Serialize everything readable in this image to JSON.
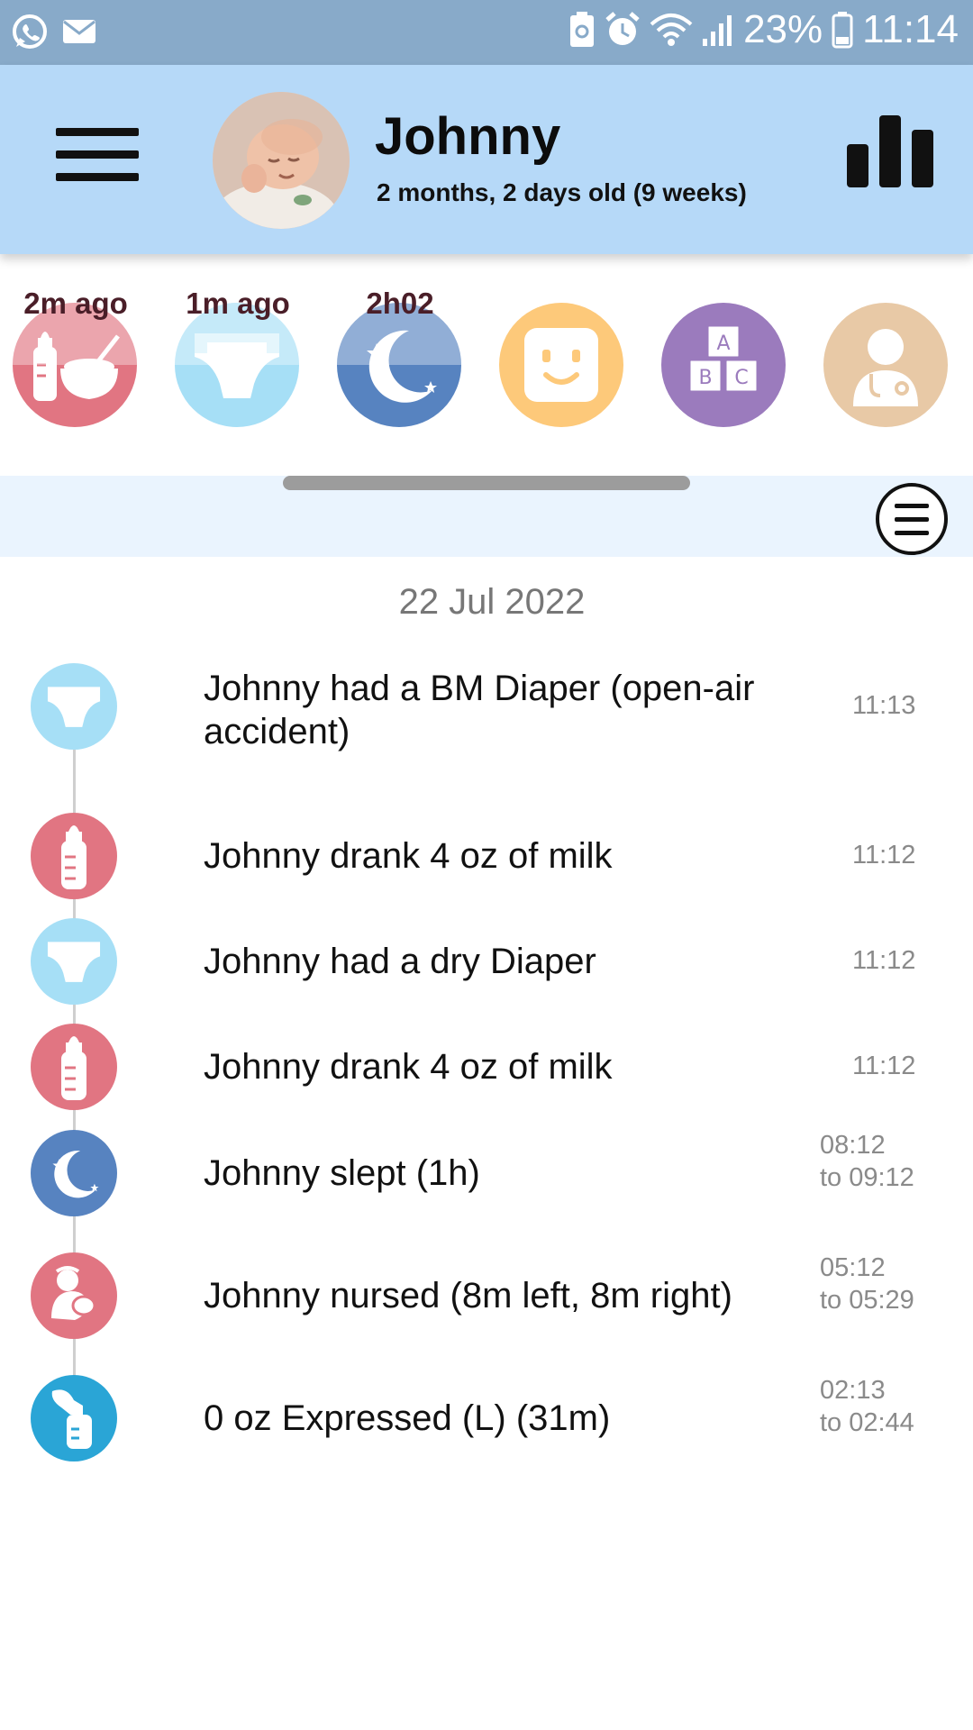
{
  "status_bar": {
    "battery_percent": "23%",
    "time": "11:14",
    "icons": [
      "whatsapp-icon",
      "mail-icon",
      "battery-saver-icon",
      "alarm-icon",
      "wifi-icon",
      "signal-icon",
      "battery-icon"
    ]
  },
  "header": {
    "name": "Johnny",
    "age": "2 months, 2 days old (9 weeks)",
    "background_color": "#b6d9f8"
  },
  "quick_actions": [
    {
      "id": "feeding",
      "label": "2m ago",
      "icon": "bottle-bowl-icon",
      "color": "#e17582"
    },
    {
      "id": "diaper",
      "label": "1m ago",
      "icon": "diaper-icon",
      "color": "#a6dff6"
    },
    {
      "id": "sleep",
      "label": "2h02",
      "icon": "moon-stars-icon",
      "color": "#5783c0"
    },
    {
      "id": "mood",
      "label": "",
      "icon": "smiley-icon",
      "color": "#fdc97a"
    },
    {
      "id": "activities",
      "label": "",
      "icon": "abc-blocks-icon",
      "color": "#9b7bbd"
    },
    {
      "id": "health",
      "label": "",
      "icon": "doctor-icon",
      "color": "#e8c9a6"
    }
  ],
  "timeline": {
    "date": "22 Jul 2022",
    "entries": [
      {
        "icon": "diaper-icon",
        "color": "#a6dff6",
        "text": "Johnny had a BM Diaper (open-air accident)",
        "time": "11:13",
        "time_end": ""
      },
      {
        "icon": "bottle-icon",
        "color": "#e17582",
        "text": "Johnny drank 4 oz of milk",
        "time": "11:12",
        "time_end": ""
      },
      {
        "icon": "diaper-icon",
        "color": "#a6dff6",
        "text": "Johnny had a dry Diaper",
        "time": "11:12",
        "time_end": ""
      },
      {
        "icon": "bottle-icon",
        "color": "#e17582",
        "text": "Johnny drank 4 oz of milk",
        "time": "11:12",
        "time_end": ""
      },
      {
        "icon": "moon-stars-icon",
        "color": "#5783c0",
        "text": "Johnny slept (1h)",
        "time": "08:12",
        "time_end": "to 09:12"
      },
      {
        "icon": "nursing-icon",
        "color": "#e17582",
        "text": "Johnny nursed (8m left, 8m right)",
        "time": "05:12",
        "time_end": "to 05:29"
      },
      {
        "icon": "breast-pump-icon",
        "color": "#2aa5d6",
        "text": "0 oz Expressed (L) (31m)",
        "time": "02:13",
        "time_end": "to 02:44"
      }
    ]
  }
}
